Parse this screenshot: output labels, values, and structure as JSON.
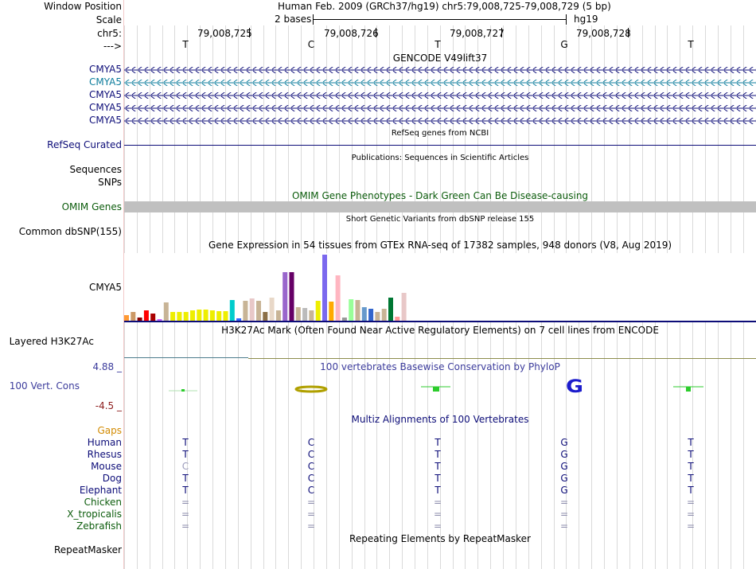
{
  "header": {
    "window_position_label": "Window Position",
    "window_position_value": "Human Feb. 2009 (GRCh37/hg19)   chr5:79,008,725-79,008,729 (5 bp)",
    "scale_label": "Scale",
    "scale_value": "2 bases",
    "assembly": "hg19",
    "chrom_label": "chr5:",
    "strand_label": "--->",
    "positions": [
      "79,008,725",
      "79,008,726",
      "79,008,727",
      "79,008,728"
    ],
    "bases": [
      "T",
      "C",
      "T",
      "G",
      "T"
    ]
  },
  "tracks": {
    "gencode_title": "GENCODE V49lift37",
    "gencode_genes": [
      "CMYA5",
      "CMYA5",
      "CMYA5",
      "CMYA5",
      "CMYA5"
    ],
    "refseq_title": "RefSeq genes from NCBI",
    "refseq_label": "RefSeq Curated",
    "pubs_title": "Publications: Sequences in Scientific Articles",
    "sequences_label": "Sequences",
    "snps_label": "SNPs",
    "omim_title": "OMIM Gene Phenotypes - Dark Green Can Be Disease-causing",
    "omim_label": "OMIM Genes",
    "dbsnp_title": "Short Genetic Variants from dbSNP release 155",
    "dbsnp_label": "Common dbSNP(155)",
    "gtex_title": "Gene Expression in 54 tissues from GTEx RNA-seq of 17382 samples, 948 donors (V8, Aug 2019)",
    "gtex_label": "CMYA5",
    "h3k_title": "H3K27Ac Mark (Often Found Near Active Regulatory Elements) on 7 cell lines from ENCODE",
    "h3k_label": "Layered H3K27Ac",
    "phylop_title": "100 vertebrates Basewise Conservation by PhyloP",
    "phylop_label": "100 Vert. Cons",
    "phylop_max": "4.88 _",
    "phylop_min": "-4.5 _",
    "multiz_title": "Multiz Alignments of 100 Vertebrates",
    "gaps_label": "Gaps",
    "species": [
      {
        "name": "Human",
        "bases": [
          "T",
          "C",
          "T",
          "G",
          "T"
        ]
      },
      {
        "name": "Rhesus",
        "bases": [
          "T",
          "C",
          "T",
          "G",
          "T"
        ]
      },
      {
        "name": "Mouse",
        "bases": [
          "C",
          "C",
          "T",
          "G",
          "T"
        ]
      },
      {
        "name": "Dog",
        "bases": [
          "T",
          "C",
          "T",
          "G",
          "T"
        ]
      },
      {
        "name": "Elephant",
        "bases": [
          "T",
          "C",
          "T",
          "G",
          "T"
        ]
      },
      {
        "name": "Chicken",
        "bases": [
          "=",
          "=",
          "=",
          "=",
          "="
        ]
      },
      {
        "name": "X_tropicalis",
        "bases": [
          "=",
          "=",
          "=",
          "=",
          "="
        ]
      },
      {
        "name": "Zebrafish",
        "bases": [
          "=",
          "=",
          "=",
          "=",
          "="
        ]
      }
    ],
    "repeat_title": "Repeating Elements by RepeatMasker",
    "repeat_label": "RepeatMasker"
  },
  "colors": {
    "gencode_blue": "#0c0c78",
    "gencode_teal": "#0c7c9c",
    "omim_green": "#0c5c0c",
    "phylop_blue": "#3c3c9c",
    "phylop_min": "#8c1c1c",
    "gaps_orange": "#d28a00",
    "mammal_blue": "#0c0c78",
    "nonmammal_green": "#0c5c0c"
  },
  "chart_data": {
    "type": "bar",
    "values": [
      8,
      12,
      5,
      14,
      10,
      3,
      24,
      12,
      12,
      12,
      14,
      15,
      15,
      14,
      13,
      13,
      27,
      4,
      26,
      29,
      26,
      12,
      30,
      14,
      62,
      62,
      18,
      17,
      14,
      26,
      84,
      25,
      58,
      5,
      28,
      27,
      18,
      16,
      12,
      16,
      30,
      6,
      36,
      1
    ],
    "colors": [
      "#ff9933",
      "#cc9966",
      "#8b0000",
      "#ff0000",
      "#aa0000",
      "#cc66ff",
      "#c8b496",
      "#eeee00",
      "#eeee00",
      "#eeee00",
      "#eeee00",
      "#eeee00",
      "#eeee00",
      "#eeee00",
      "#eeee00",
      "#eeee00",
      "#00cccc",
      "#3366ff",
      "#c8b496",
      "#e8c8c8",
      "#c8b496",
      "#8b6f47",
      "#e8d8c8",
      "#c8b496",
      "#9966cc",
      "#660066",
      "#c8b496",
      "#bbbbbb",
      "#c8b496",
      "#eeee00",
      "#7b68ee",
      "#ffaa00",
      "#ffb6c1",
      "#999999",
      "#99ff99",
      "#c8b496",
      "#6699cc",
      "#3366cc",
      "#c8b496",
      "#c8b496",
      "#007733",
      "#ff9999",
      "#e8c8c8",
      "#c8b496"
    ]
  }
}
